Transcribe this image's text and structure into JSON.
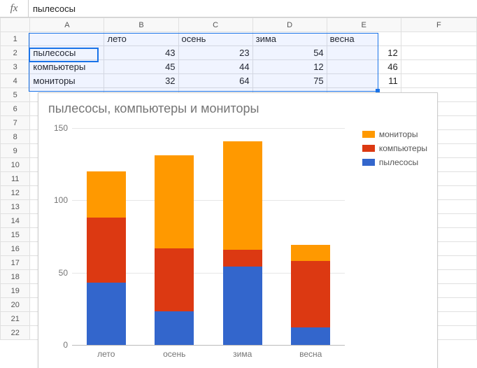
{
  "formula_bar": {
    "fx_symbol": "fx",
    "value": "пылесосы"
  },
  "columns": [
    "A",
    "B",
    "C",
    "D",
    "E",
    "F"
  ],
  "row_numbers": [
    "1",
    "2",
    "3",
    "4",
    "5",
    "6",
    "7",
    "8",
    "9",
    "10",
    "11",
    "12",
    "13",
    "14",
    "15",
    "16",
    "17",
    "18",
    "19",
    "20",
    "21",
    "22"
  ],
  "table": {
    "header": {
      "A": "",
      "B": "лето",
      "C": "осень",
      "D": "зима",
      "E": "весна"
    },
    "rows": [
      {
        "A": "пылесосы",
        "B": "43",
        "C": "23",
        "D": "54",
        "E": "12"
      },
      {
        "A": "компьютеры",
        "B": "45",
        "C": "44",
        "D": "12",
        "E": "46"
      },
      {
        "A": "мониторы",
        "B": "32",
        "C": "64",
        "D": "75",
        "E": "11"
      }
    ]
  },
  "chart_data": {
    "type": "bar",
    "stacked": true,
    "title": "пылесосы, компьютеры и мониторы",
    "categories": [
      "лето",
      "осень",
      "зима",
      "весна"
    ],
    "series": [
      {
        "name": "пылесосы",
        "color": "#3366cc",
        "values": [
          43,
          23,
          54,
          12
        ]
      },
      {
        "name": "компьютеры",
        "color": "#dc3912",
        "values": [
          45,
          44,
          12,
          46
        ]
      },
      {
        "name": "мониторы",
        "color": "#ff9900",
        "values": [
          32,
          64,
          75,
          11
        ]
      }
    ],
    "legend_order": [
      "мониторы",
      "компьютеры",
      "пылесосы"
    ],
    "ylim": [
      0,
      150
    ],
    "yticks": [
      0,
      50,
      100,
      150
    ],
    "xlabel": "",
    "ylabel": ""
  }
}
